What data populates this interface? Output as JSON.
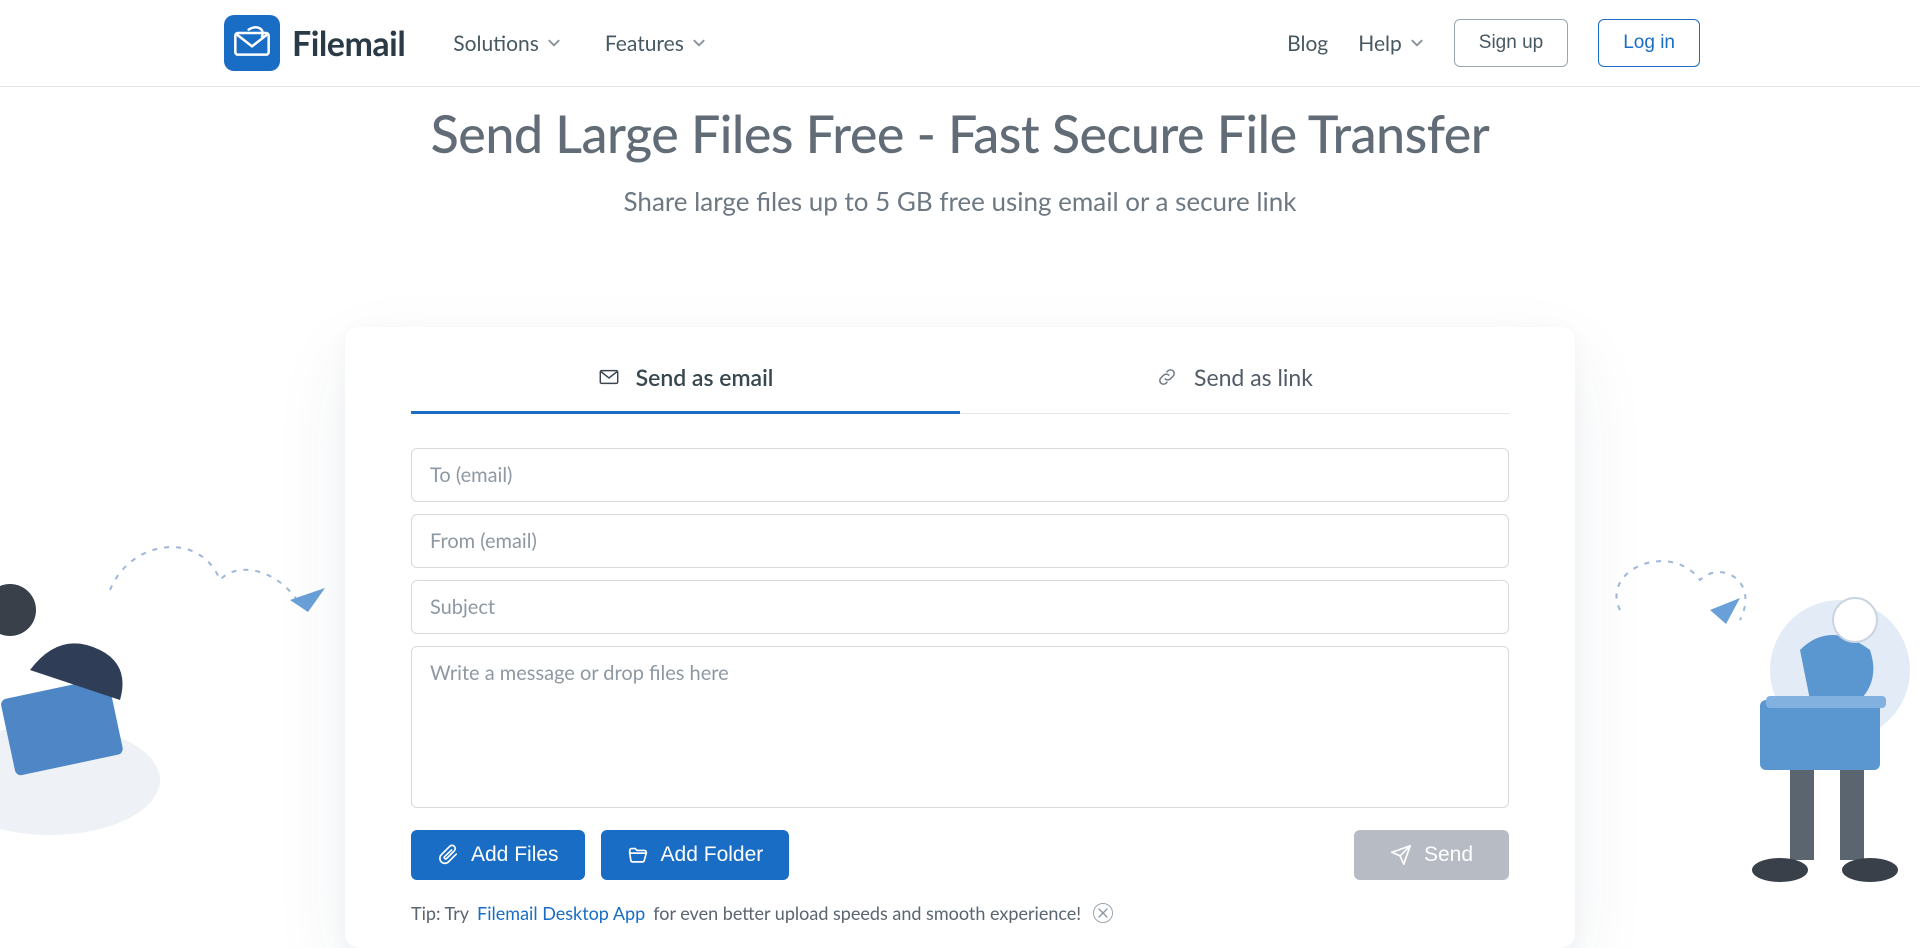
{
  "brand": {
    "name": "Filemail"
  },
  "nav": {
    "solutions": "Solutions",
    "features": "Features",
    "blog": "Blog",
    "help": "Help",
    "signup": "Sign up",
    "login": "Log in"
  },
  "hero": {
    "title": "Send Large Files Free - Fast Secure File Transfer",
    "subtitle": "Share large files up to 5 GB free using email or a secure link"
  },
  "tabs": {
    "email": "Send as email",
    "link": "Send as link"
  },
  "form": {
    "to_placeholder": "To (email)",
    "from_placeholder": "From (email)",
    "subject_placeholder": "Subject",
    "message_placeholder": "Write a message or drop files here"
  },
  "buttons": {
    "add_files": "Add Files",
    "add_folder": "Add Folder",
    "send": "Send"
  },
  "tip": {
    "prefix": "Tip: Try ",
    "link": "Filemail Desktop App",
    "suffix": " for even better upload speeds and smooth experience!"
  }
}
